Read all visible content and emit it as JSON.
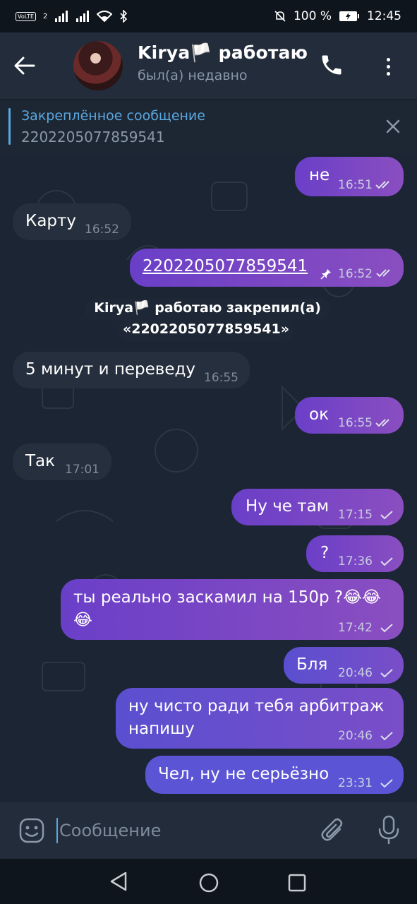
{
  "status_bar": {
    "volte": "VoLTE",
    "sim": "2",
    "battery_text": "100 %",
    "time": "12:45"
  },
  "header": {
    "contact_name": "Kirya🏳️ работаю",
    "contact_status": "был(а) недавно"
  },
  "pinned": {
    "title": "Закреплённое сообщение",
    "text": "2202205077859541"
  },
  "messages": [
    {
      "side": "out",
      "text": "не",
      "time": "16:51",
      "checks": "double"
    },
    {
      "side": "in",
      "text": "Карту",
      "time": "16:52"
    },
    {
      "side": "out",
      "text": "2202205077859541",
      "time": "16:52",
      "checks": "double",
      "pinned": true
    },
    {
      "side": "in",
      "text": "5 минут и переведу",
      "time": "16:55"
    },
    {
      "side": "out",
      "text": "ок",
      "time": "16:55",
      "checks": "double"
    },
    {
      "side": "in",
      "text": "Так",
      "time": "17:01"
    },
    {
      "side": "out",
      "text": "Ну че там",
      "time": "17:15",
      "checks": "single"
    },
    {
      "side": "out",
      "text": "?",
      "time": "17:36",
      "checks": "single"
    },
    {
      "side": "out",
      "text_line1": "ты реально заскамил на 150р ?😂😂",
      "text_line2": "😂",
      "time": "17:42",
      "checks": "single"
    },
    {
      "side": "out",
      "text": "Бля",
      "time": "20:46",
      "checks": "single"
    },
    {
      "side": "out",
      "text_line1": "ну чисто ради тебя  арбитраж",
      "text_line2": "напишу",
      "time": "20:46",
      "checks": "single"
    },
    {
      "side": "out",
      "text": "Чел, ну не серьёзно",
      "time": "23:31",
      "checks": "single"
    }
  ],
  "service_message": {
    "line1": "Kirya🏳️ работаю закрепил(а)",
    "line2": "«2202205077859541»"
  },
  "input": {
    "placeholder": "Сообщение"
  },
  "colors": {
    "accent": "#5ba8e0",
    "outgoing_bubble": "#7a48c6",
    "incoming_bubble": "#252f3d",
    "chat_background": "#1b2533"
  }
}
